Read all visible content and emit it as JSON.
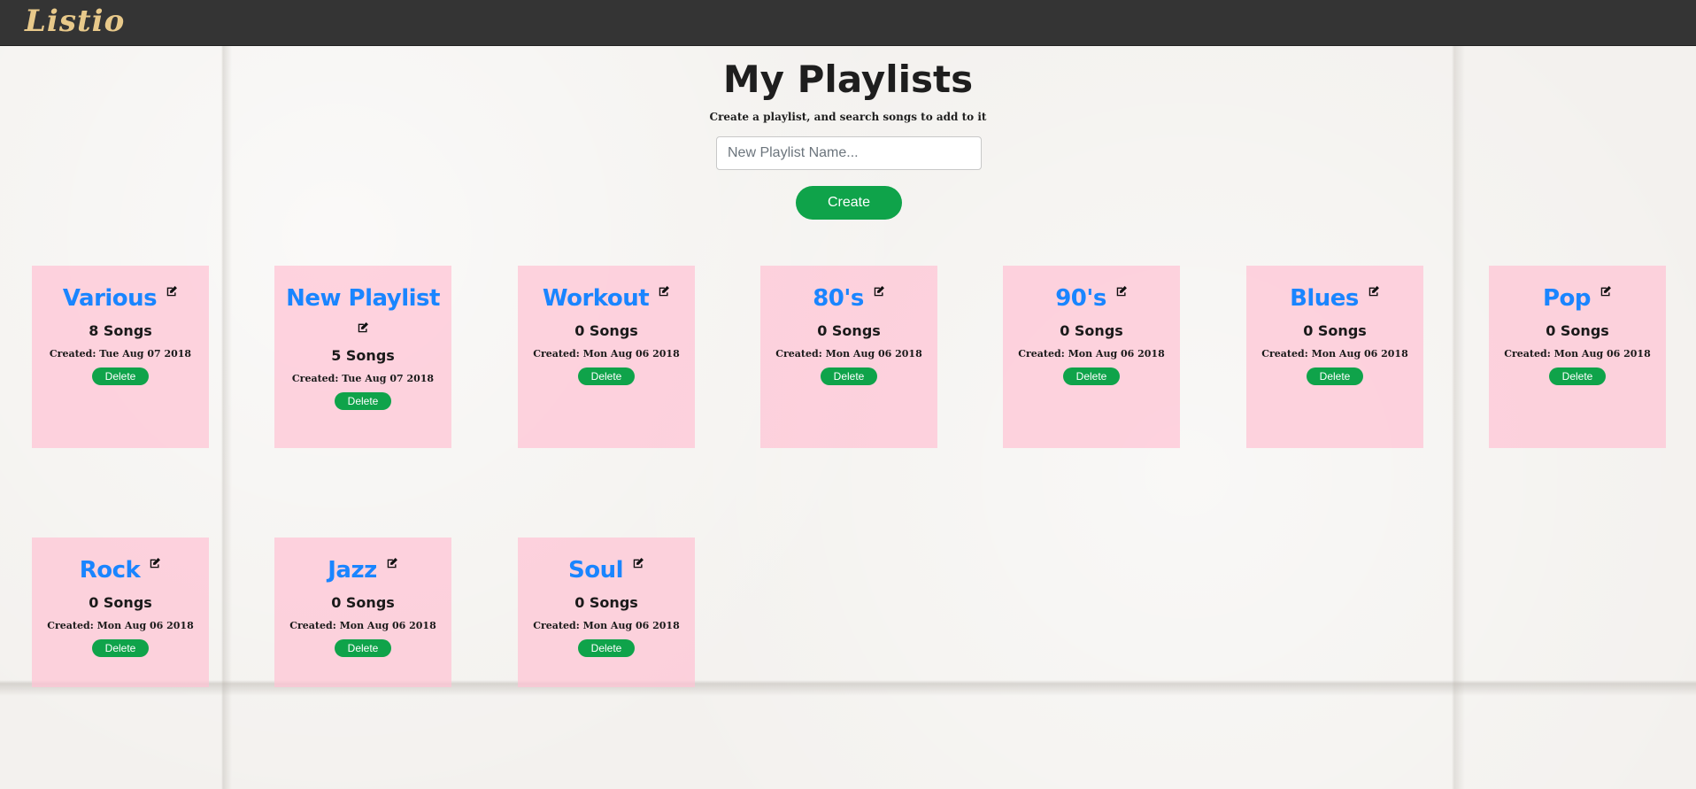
{
  "brand": "Listio",
  "header": {
    "title": "My Playlists",
    "subtitle": "Create a playlist, and search songs to add to it"
  },
  "form": {
    "placeholder": "New Playlist Name...",
    "create_label": "Create"
  },
  "playlists": [
    {
      "name": "Various",
      "count": "8 Songs",
      "created": "Created: Tue Aug 07 2018",
      "delete_label": "Delete"
    },
    {
      "name": "New Playlist",
      "count": "5 Songs",
      "created": "Created: Tue Aug 07 2018",
      "delete_label": "Delete"
    },
    {
      "name": "Workout",
      "count": "0 Songs",
      "created": "Created: Mon Aug 06 2018",
      "delete_label": "Delete"
    },
    {
      "name": "80's",
      "count": "0 Songs",
      "created": "Created: Mon Aug 06 2018",
      "delete_label": "Delete"
    },
    {
      "name": "90's",
      "count": "0 Songs",
      "created": "Created: Mon Aug 06 2018",
      "delete_label": "Delete"
    },
    {
      "name": "Blues",
      "count": "0 Songs",
      "created": "Created: Mon Aug 06 2018",
      "delete_label": "Delete"
    },
    {
      "name": "Pop",
      "count": "0 Songs",
      "created": "Created: Mon Aug 06 2018",
      "delete_label": "Delete"
    },
    {
      "name": "Rock",
      "count": "0 Songs",
      "created": "Created: Mon Aug 06 2018",
      "delete_label": "Delete"
    },
    {
      "name": "Jazz",
      "count": "0 Songs",
      "created": "Created: Mon Aug 06 2018",
      "delete_label": "Delete"
    },
    {
      "name": "Soul",
      "count": "0 Songs",
      "created": "Created: Mon Aug 06 2018",
      "delete_label": "Delete"
    }
  ],
  "colors": {
    "navbar": "#343434",
    "brand": "#e8c98a",
    "card_bg": "#ffc4d4",
    "playlist_name": "#1a85ff",
    "button_green": "#0fa34a"
  },
  "icons": {
    "edit": "edit-icon"
  }
}
